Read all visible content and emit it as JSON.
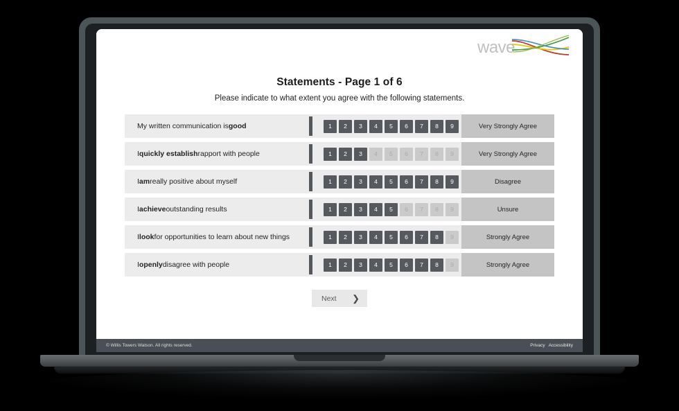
{
  "brand": {
    "logo_text": "wave",
    "logo_icon": "wave-swoosh-icon",
    "colors": [
      "#c0392b",
      "#e8c600",
      "#3a9e3a",
      "#4a90c4"
    ]
  },
  "header": {
    "title": "Statements - Page 1 of 6",
    "subtitle": "Please indicate to what extent you agree with the following statements."
  },
  "scale": {
    "values": [
      "1",
      "2",
      "3",
      "4",
      "5",
      "6",
      "7",
      "8",
      "9"
    ],
    "max": 9
  },
  "statements": [
    {
      "prefix": "My written communication is ",
      "emphasis": "good",
      "suffix": "",
      "filled": 9,
      "answer": "Very Strongly Agree"
    },
    {
      "prefix": "I ",
      "emphasis": "quickly establish",
      "suffix": " rapport with people",
      "filled": 3,
      "answer": "Very Strongly Agree"
    },
    {
      "prefix": "I ",
      "emphasis": "am",
      "suffix": " really positive about myself",
      "filled": 9,
      "answer": "Disagree"
    },
    {
      "prefix": "I ",
      "emphasis": "achieve",
      "suffix": " outstanding results",
      "filled": 5,
      "answer": "Unsure"
    },
    {
      "prefix": "I ",
      "emphasis": "look",
      "suffix": " for opportunities to learn about new things",
      "filled": 8,
      "answer": "Strongly Agree"
    },
    {
      "prefix": "I ",
      "emphasis": "openly",
      "suffix": " disagree with people",
      "filled": 8,
      "answer": "Strongly Agree"
    }
  ],
  "next_button": {
    "label": "Next",
    "icon": "chevron-right-icon"
  },
  "footer": {
    "copyright": "© Willis Towers Watson. All rights reserved.",
    "links": [
      "Privacy",
      "Accessibility"
    ]
  },
  "theme": {
    "row_bg": "#ececec",
    "answer_bg": "#c4c4c4",
    "box_on": "#56595d",
    "box_off": "#cacaca",
    "footer_bg": "#4a4f57",
    "bezel": "#4b5457"
  }
}
